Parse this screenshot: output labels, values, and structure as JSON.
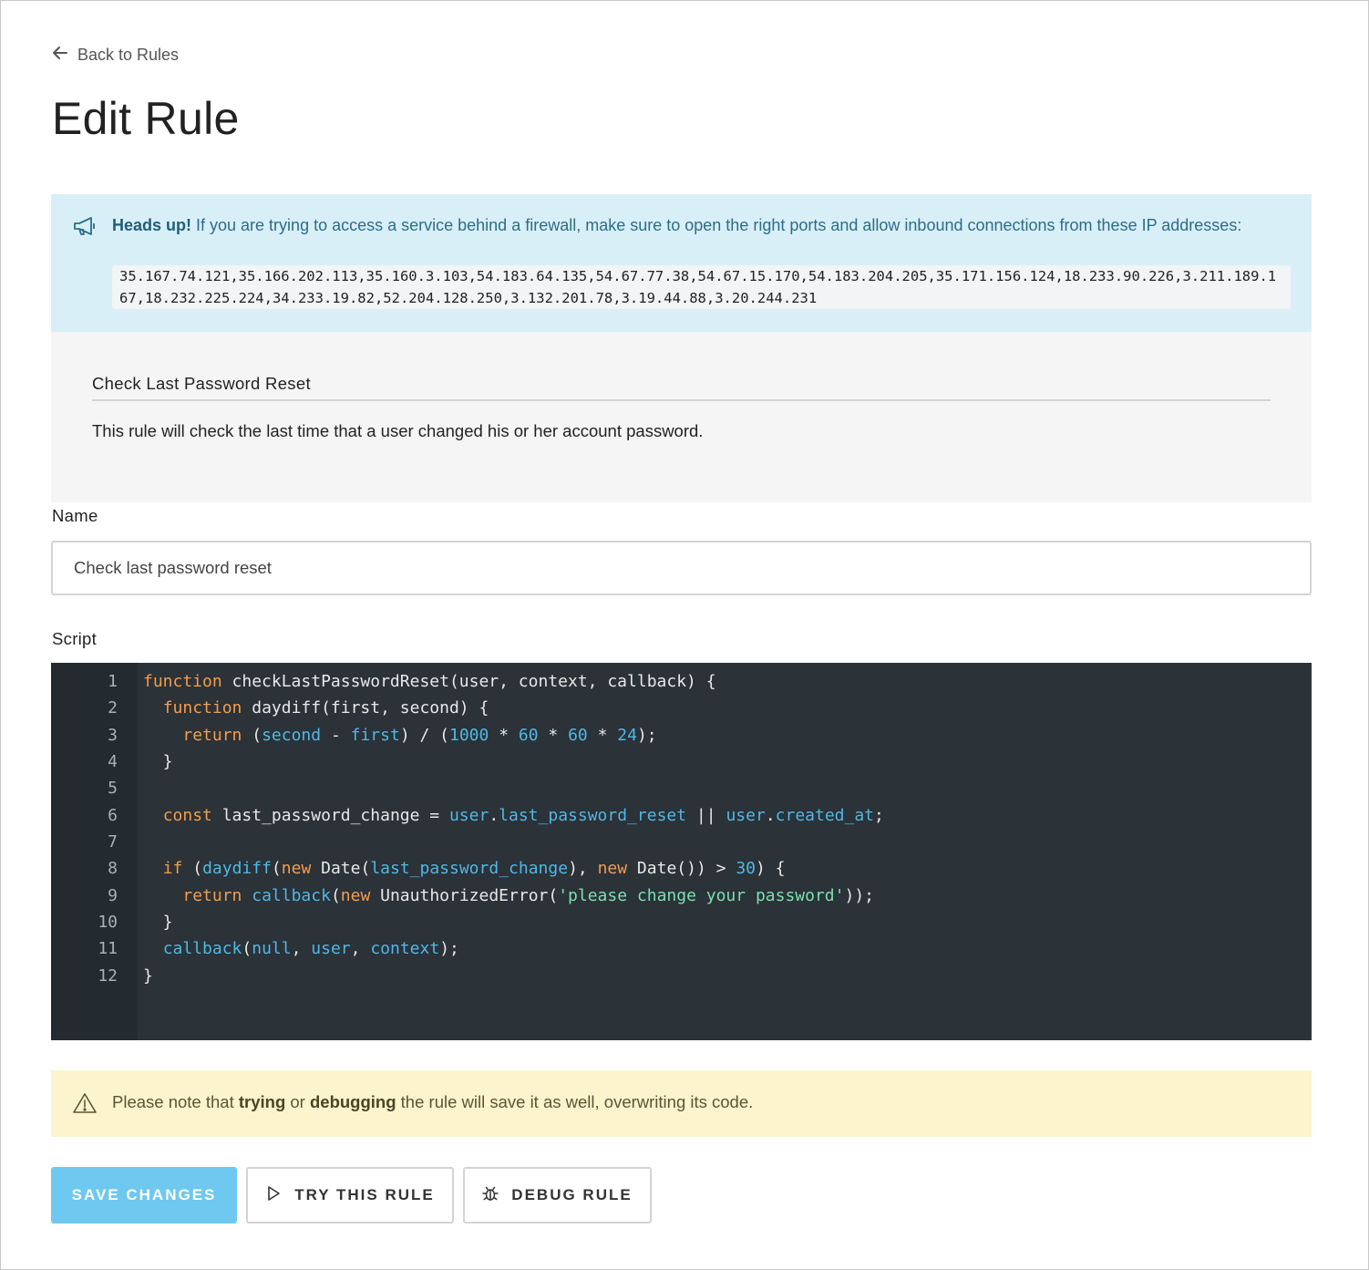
{
  "nav": {
    "back_label": "Back to Rules"
  },
  "page": {
    "title": "Edit Rule"
  },
  "info_alert": {
    "heading": "Heads up!",
    "message": " If you are trying to access a service behind a firewall, make sure to open the right ports and allow inbound connections from these IP addresses:",
    "ip_addresses": "35.167.74.121,35.166.202.113,35.160.3.103,54.183.64.135,54.67.77.38,54.67.15.170,54.183.204.205,35.171.156.124,18.233.90.226,3.211.189.167,18.232.225.224,34.233.19.82,52.204.128.250,3.132.201.78,3.19.44.88,3.20.244.231",
    "icon": "megaphone-icon"
  },
  "template_info": {
    "title": "Check Last Password Reset",
    "description": "This rule will check the last time that a user changed his or her account password."
  },
  "form": {
    "name_label": "Name",
    "name_value": "Check last password reset",
    "script_label": "Script"
  },
  "editor": {
    "line_numbers": [
      "1",
      "2",
      "3",
      "4",
      "5",
      "6",
      "7",
      "8",
      "9",
      "10",
      "11",
      "12"
    ],
    "lines": [
      "function checkLastPasswordReset(user, context, callback) {",
      "  function daydiff(first, second) {",
      "    return (second - first) / (1000 * 60 * 60 * 24);",
      "  }",
      "",
      "  const last_password_change = user.last_password_reset || user.created_at;",
      "",
      "  if (daydiff(new Date(last_password_change), new Date()) > 30) {",
      "    return callback(new UnauthorizedError('please change your password'));",
      "  }",
      "  callback(null, user, context);",
      "}"
    ]
  },
  "warning_alert": {
    "prefix": "Please note that ",
    "bold1": "trying",
    "mid": " or ",
    "bold2": "debugging",
    "suffix": " the rule will save it as well, overwriting its code.",
    "icon": "warning-triangle-icon"
  },
  "buttons": {
    "save_label": "SAVE CHANGES",
    "try_label": "TRY THIS RULE",
    "debug_label": "DEBUG RULE"
  },
  "colors": {
    "info_bg": "#d9eff7",
    "warn_bg": "#fcf4cd",
    "primary_button": "#6ec8ef",
    "editor_bg": "#2b3238",
    "keyword": "#f39c4e",
    "identifier": "#4fb8e6",
    "string": "#7be0b0"
  }
}
